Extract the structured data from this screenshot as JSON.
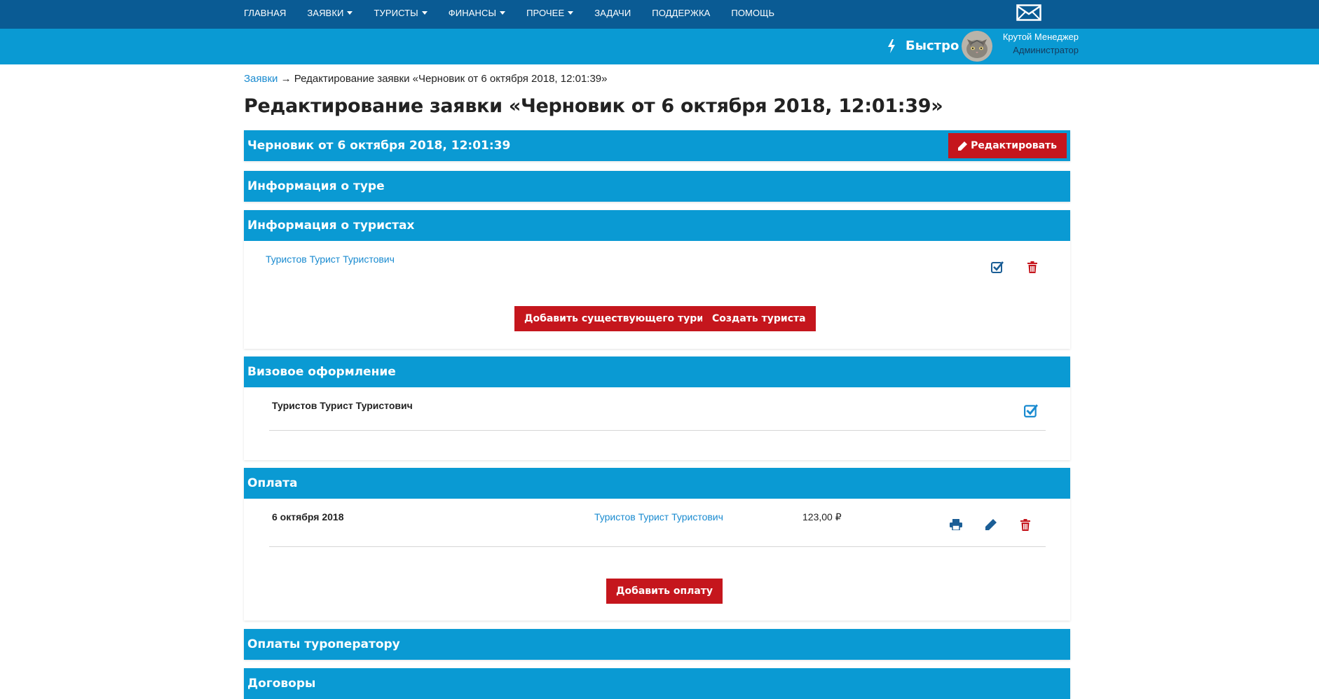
{
  "nav": {
    "items": [
      {
        "label": "Главная",
        "dropdown": false
      },
      {
        "label": "Заявки",
        "dropdown": true
      },
      {
        "label": "Туристы",
        "dropdown": true
      },
      {
        "label": "Финансы",
        "dropdown": true
      },
      {
        "label": "Прочее",
        "dropdown": true
      },
      {
        "label": "Задачи",
        "dropdown": false
      },
      {
        "label": "Поддержка",
        "dropdown": false
      },
      {
        "label": "Помощь",
        "dropdown": false
      }
    ],
    "mail_icon": "envelope-icon"
  },
  "header": {
    "quick_label": "Быстро",
    "quick_icon": "lightning-icon",
    "user_name": "Крутой Менеджер",
    "user_role": "Администратор"
  },
  "breadcrumb": {
    "parent": "Заявки",
    "separator": "→",
    "current": "Редактирование заявки «Черновик от 6 октября 2018, 12:01:39»"
  },
  "page_title": "Редактирование заявки «Черновик от 6 октября 2018, 12:01:39»",
  "panels": {
    "draft": {
      "title": "Черновик от 6 октября 2018, 12:01:39",
      "edit_label": "Редактировать"
    },
    "tour_info": {
      "title": "Информация о туре"
    },
    "tourists": {
      "title": "Информация о туристах",
      "tourist_name": "Туристов Турист Туристович",
      "add_existing_label": "Добавить существующего туриста",
      "create_label": "Создать туриста"
    },
    "visa": {
      "title": "Визовое оформление",
      "tourist_name": "Туристов Турист Туристович"
    },
    "payment": {
      "title": "Оплата",
      "row": {
        "date": "6 октября 2018",
        "tourist": "Туристов Турист Туристович",
        "amount": "123,00 ₽"
      },
      "add_label": "Добавить оплату"
    },
    "operator_payments": {
      "title": "Оплаты туроператору"
    },
    "contracts": {
      "title": "Договоры"
    }
  },
  "colors": {
    "nav_bg": "#0a5b94",
    "accent": "#0a9ad3",
    "danger": "#c5161d",
    "link": "#1a8bd0"
  }
}
